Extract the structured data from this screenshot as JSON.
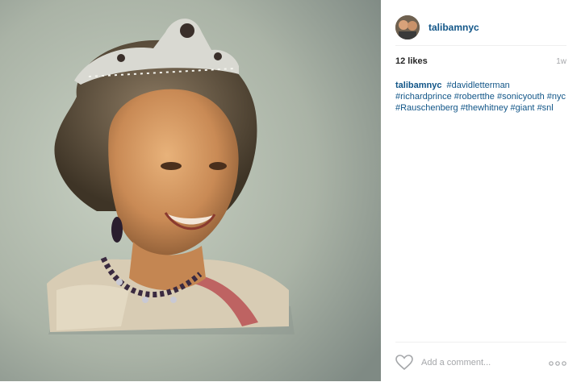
{
  "post": {
    "username": "talibamnyc",
    "likes": "12 likes",
    "time": "1w",
    "caption": {
      "username": "talibamnyc",
      "hashtags": [
        "#davidletterman",
        "#richardprince",
        "#robertthe",
        "#sonicyouth",
        "#nyc",
        "#Rauschenberg",
        "#thewhitney",
        "#giant",
        "#snl"
      ]
    },
    "comment_placeholder": "Add a comment..."
  },
  "icons": {
    "like": "heart-icon",
    "more": "more-options-icon"
  },
  "colors": {
    "link": "#125688",
    "muted": "#a5a7aa",
    "text": "#262626",
    "divider": "#efefef"
  }
}
